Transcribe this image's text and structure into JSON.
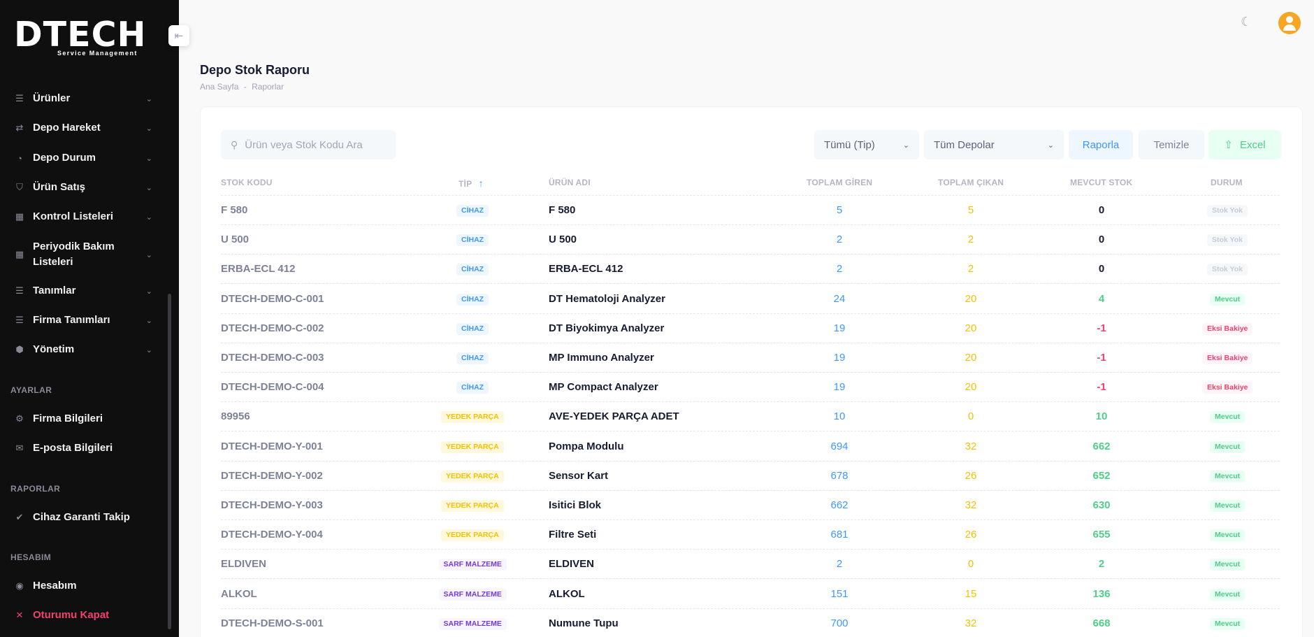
{
  "brand": {
    "name": "DTECH",
    "tagline": "Service Management"
  },
  "menu": [
    {
      "label": "Ürünler",
      "icon": "list-icon",
      "glyph": "☰"
    },
    {
      "label": "Depo Hareket",
      "icon": "transfer-icon",
      "glyph": "⇄"
    },
    {
      "label": "Depo Durum",
      "icon": "pie-chart-icon",
      "glyph": "◔"
    },
    {
      "label": "Ürün Satış",
      "icon": "basket-icon",
      "glyph": "⛉"
    },
    {
      "label": "Kontrol Listeleri",
      "icon": "grid-add-icon",
      "glyph": "▦"
    },
    {
      "label": "Periyodik Bakım Listeleri",
      "icon": "grid-add-icon",
      "glyph": "▦"
    },
    {
      "label": "Tanımlar",
      "icon": "list-icon",
      "glyph": "☰"
    },
    {
      "label": "Firma Tanımları",
      "icon": "list-icon",
      "glyph": "☰"
    },
    {
      "label": "Yönetim",
      "icon": "shield-icon",
      "glyph": "⬢"
    }
  ],
  "sections": {
    "settings": "AYARLAR",
    "reports": "RAPORLAR",
    "account": "HESABIM"
  },
  "settings_items": [
    {
      "label": "Firma Bilgileri",
      "icon": "gear-icon",
      "glyph": "⚙"
    },
    {
      "label": "E-posta Bilgileri",
      "icon": "mail-icon",
      "glyph": "✉"
    }
  ],
  "report_items": [
    {
      "label": "Cihaz Garanti Takip",
      "icon": "verified-icon",
      "glyph": "✔"
    }
  ],
  "account_items": [
    {
      "label": "Hesabım",
      "icon": "user-circle-icon",
      "glyph": "◉"
    },
    {
      "label": "Oturumu Kapat",
      "icon": "logout-icon",
      "glyph": "✕"
    }
  ],
  "page": {
    "title": "Depo Stok Raporu",
    "breadcrumb": [
      "Ana Sayfa",
      "-",
      "Raporlar"
    ]
  },
  "filters": {
    "search_placeholder": "Ürün veya Stok Kodu Ara",
    "type_select": "Tümü (Tip)",
    "depot_select": "Tüm Depolar",
    "report_button": "Raporla",
    "clear_button": "Temizle",
    "excel_button": "Excel"
  },
  "table": {
    "headers": [
      "STOK KODU",
      "TİP",
      "ÜRÜN ADI",
      "TOPLAM GİREN",
      "TOPLAM ÇIKAN",
      "MEVCUT STOK",
      "DURUM"
    ],
    "sort_indicator": "↑",
    "rows": [
      {
        "code": "F 580",
        "type": "CİHAZ",
        "name": "F 580",
        "in": "5",
        "out": "5",
        "stock": "0",
        "status": "Stok Yok"
      },
      {
        "code": "U 500",
        "type": "CİHAZ",
        "name": "U 500",
        "in": "2",
        "out": "2",
        "stock": "0",
        "status": "Stok Yok"
      },
      {
        "code": "ERBA-ECL 412",
        "type": "CİHAZ",
        "name": "ERBA-ECL 412",
        "in": "2",
        "out": "2",
        "stock": "0",
        "status": "Stok Yok"
      },
      {
        "code": "DTECH-DEMO-C-001",
        "type": "CİHAZ",
        "name": "DT Hematoloji Analyzer",
        "in": "24",
        "out": "20",
        "stock": "4",
        "status": "Mevcut"
      },
      {
        "code": "DTECH-DEMO-C-002",
        "type": "CİHAZ",
        "name": "DT Biyokimya Analyzer",
        "in": "19",
        "out": "20",
        "stock": "-1",
        "status": "Eksi Bakiye"
      },
      {
        "code": "DTECH-DEMO-C-003",
        "type": "CİHAZ",
        "name": "MP Immuno Analyzer",
        "in": "19",
        "out": "20",
        "stock": "-1",
        "status": "Eksi Bakiye"
      },
      {
        "code": "DTECH-DEMO-C-004",
        "type": "CİHAZ",
        "name": "MP Compact Analyzer",
        "in": "19",
        "out": "20",
        "stock": "-1",
        "status": "Eksi Bakiye"
      },
      {
        "code": "89956",
        "type": "YEDEK PARÇA",
        "name": "AVE-YEDEK PARÇA ADET",
        "in": "10",
        "out": "0",
        "stock": "10",
        "status": "Mevcut"
      },
      {
        "code": "DTECH-DEMO-Y-001",
        "type": "YEDEK PARÇA",
        "name": "Pompa Modulu",
        "in": "694",
        "out": "32",
        "stock": "662",
        "status": "Mevcut"
      },
      {
        "code": "DTECH-DEMO-Y-002",
        "type": "YEDEK PARÇA",
        "name": "Sensor Kart",
        "in": "678",
        "out": "26",
        "stock": "652",
        "status": "Mevcut"
      },
      {
        "code": "DTECH-DEMO-Y-003",
        "type": "YEDEK PARÇA",
        "name": "Isitici Blok",
        "in": "662",
        "out": "32",
        "stock": "630",
        "status": "Mevcut"
      },
      {
        "code": "DTECH-DEMO-Y-004",
        "type": "YEDEK PARÇA",
        "name": "Filtre Seti",
        "in": "681",
        "out": "26",
        "stock": "655",
        "status": "Mevcut"
      },
      {
        "code": "ELDIVEN",
        "type": "SARF MALZEME",
        "name": "ELDIVEN",
        "in": "2",
        "out": "0",
        "stock": "2",
        "status": "Mevcut"
      },
      {
        "code": "ALKOL",
        "type": "SARF MALZEME",
        "name": "ALKOL",
        "in": "151",
        "out": "15",
        "stock": "136",
        "status": "Mevcut"
      },
      {
        "code": "DTECH-DEMO-S-001",
        "type": "SARF MALZEME",
        "name": "Numune Tupu",
        "in": "700",
        "out": "32",
        "stock": "668",
        "status": "Mevcut"
      }
    ]
  },
  "colors": {
    "sidebar_bg": "#0f0f10",
    "primary": "#3e97ff",
    "warning": "#f6c000",
    "success": "#50cd89",
    "danger": "#f1416c",
    "avatar": "#f6a623"
  }
}
